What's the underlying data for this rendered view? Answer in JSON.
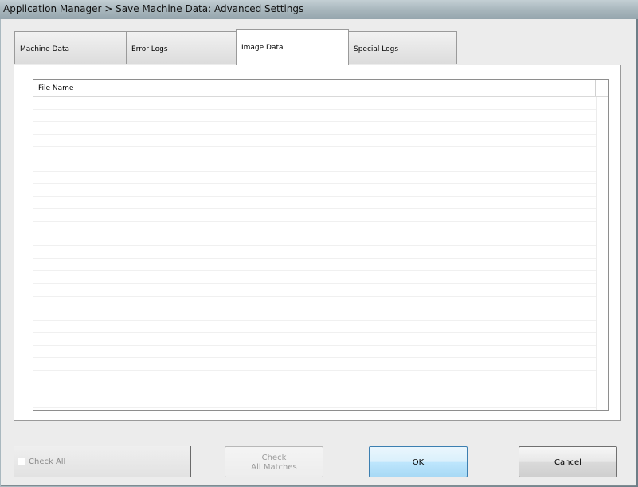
{
  "window": {
    "title": "Application Manager > Save Machine Data: Advanced Settings"
  },
  "tabs": [
    {
      "label": "Machine Data",
      "active": false
    },
    {
      "label": "Error Logs",
      "active": false
    },
    {
      "label": "Image Data",
      "active": true
    },
    {
      "label": "Special Logs",
      "active": false
    }
  ],
  "file_list": {
    "columns": [
      "File Name"
    ],
    "rows": []
  },
  "footer": {
    "check_all_label": "Check All",
    "check_all_checked": false,
    "check_matches_line1": "Check",
    "check_matches_line2": "All Matches",
    "ok_label": "OK",
    "cancel_label": "Cancel"
  }
}
